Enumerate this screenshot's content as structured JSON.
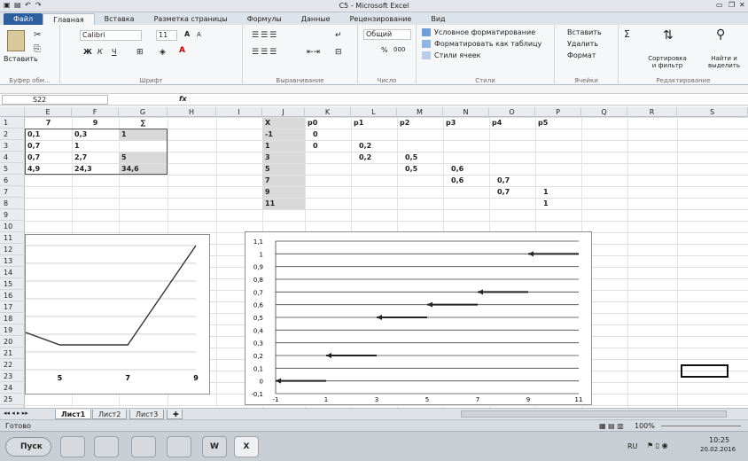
{
  "window": {
    "title": "C5 - Microsoft Excel"
  },
  "tabs": [
    "Файл",
    "Главная",
    "Вставка",
    "Разметка страницы",
    "Формулы",
    "Данные",
    "Рецензирование",
    "Вид"
  ],
  "ribbon": {
    "clipboard": {
      "paste": "Вставить",
      "label": "Буфер обм..."
    },
    "font": {
      "name": "Calibri",
      "size": "11",
      "label": "Шрифт",
      "bold": "Ж",
      "italic": "К",
      "underline": "Ч",
      "grow": "A",
      "shrink": "A"
    },
    "align": {
      "label": "Выравнивание"
    },
    "number": {
      "format": "Общий",
      "percent": "%",
      "thousands": "000",
      "label": "Число"
    },
    "styles": {
      "cond": "Условное форматирование",
      "table": "Форматировать как таблицу",
      "cell": "Стили ячеек",
      "label": "Стили"
    },
    "cells": {
      "insert": "Вставить",
      "delete": "Удалить",
      "format": "Формат",
      "label": "Ячейки"
    },
    "edit": {
      "sort": "Сортировка и фильтр",
      "find": "Найти и выделить",
      "label": "Редактирование",
      "sum": "Σ"
    }
  },
  "formula": {
    "name": "S22",
    "fx": "fx",
    "content": ""
  },
  "columns": [
    "E",
    "F",
    "G",
    "H",
    "I",
    "J",
    "K",
    "L",
    "M",
    "N",
    "O",
    "P",
    "Q",
    "R",
    "S"
  ],
  "rows": [
    "1",
    "2",
    "3",
    "4",
    "5",
    "6",
    "7",
    "8",
    "9",
    "10",
    "11",
    "12",
    "13",
    "14",
    "15",
    "16",
    "17",
    "18",
    "19",
    "20",
    "21",
    "22",
    "23",
    "24",
    "25"
  ],
  "table_efg": [
    [
      "7",
      "9",
      "∑"
    ],
    [
      "0,1",
      "0,3",
      "1"
    ],
    [
      "0,7",
      "1",
      ""
    ],
    [
      "0,7",
      "2,7",
      "5"
    ],
    [
      "4,9",
      "24,3",
      "34,6"
    ]
  ],
  "table_jp": {
    "header": [
      "X",
      "p0",
      "p1",
      "p2",
      "p3",
      "p4",
      "p5"
    ],
    "x": [
      "-1",
      "1",
      "3",
      "5",
      "7",
      "9",
      "11"
    ],
    "cells": [
      [
        "0",
        "",
        "",
        "",
        "",
        ""
      ],
      [
        "0",
        "0,2",
        "",
        "",
        "",
        ""
      ],
      [
        "",
        "0,2",
        "0,5",
        "",
        "",
        ""
      ],
      [
        "",
        "",
        "0,5",
        "0,6",
        "",
        ""
      ],
      [
        "",
        "",
        "",
        "0,6",
        "0,7",
        ""
      ],
      [
        "",
        "",
        "",
        "",
        "0,7",
        "1"
      ],
      [
        "",
        "",
        "",
        "",
        "",
        "1"
      ]
    ]
  },
  "chart_data": [
    {
      "type": "line",
      "x": [
        4,
        5,
        7,
        9
      ],
      "y": [
        3,
        2,
        2,
        10
      ],
      "categories": [
        "5",
        "7",
        "9"
      ],
      "title": "",
      "xlabel": "",
      "ylabel": ""
    },
    {
      "type": "line",
      "series_segments": [
        [
          -1,
          1,
          0
        ],
        [
          1,
          3,
          0.2
        ],
        [
          3,
          5,
          0.5
        ],
        [
          5,
          7,
          0.6
        ],
        [
          7,
          9,
          0.7
        ],
        [
          9,
          11,
          1
        ]
      ],
      "x_ticks": [
        "-1",
        "1",
        "3",
        "5",
        "7",
        "9",
        "11"
      ],
      "y_ticks": [
        "-0,1",
        "0",
        "0,1",
        "0,2",
        "0,3",
        "0,4",
        "0,5",
        "0,6",
        "0,7",
        "0,8",
        "0,9",
        "1",
        "1,1"
      ],
      "xlim": [
        -1,
        11
      ],
      "ylim": [
        -0.1,
        1.1
      ],
      "grid": true,
      "title": "",
      "xlabel": "",
      "ylabel": ""
    }
  ],
  "sheets": [
    "Лист1",
    "Лист2",
    "Лист3"
  ],
  "status": {
    "ready": "Готово",
    "zoom": "100%"
  },
  "taskbar": {
    "start": "Пуск",
    "lang": "RU",
    "time": "10:25",
    "date": "20.02.2016"
  }
}
